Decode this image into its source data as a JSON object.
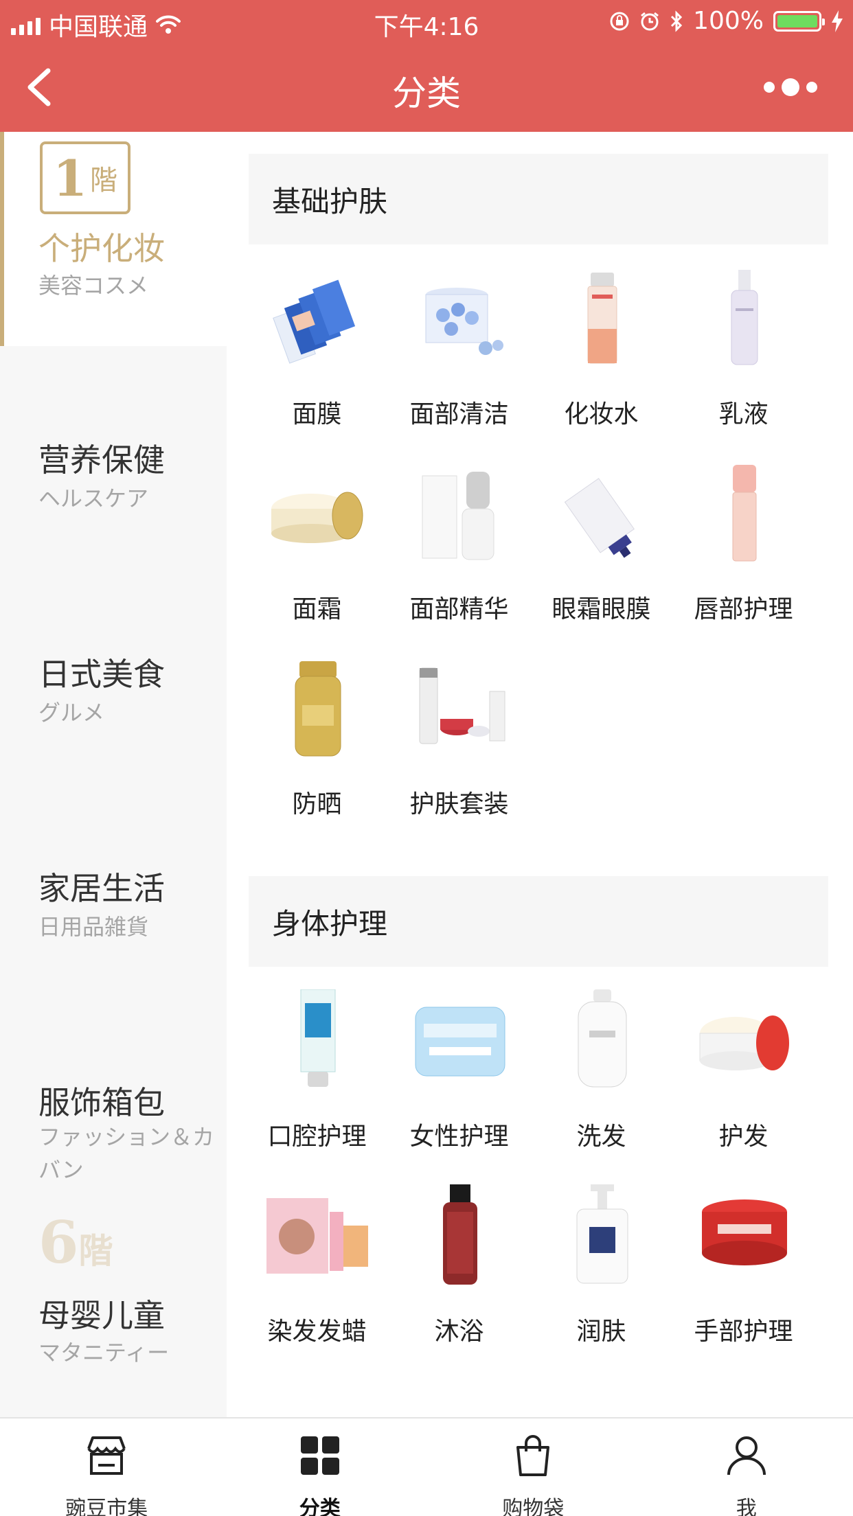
{
  "status_bar": {
    "carrier": "中国联通",
    "time": "下午4:16",
    "battery": "100%",
    "battery_level": 1.0,
    "battery_color": "#6edc5f"
  },
  "nav": {
    "title": "分类",
    "back_icon": "chevron-left-icon",
    "more_icon": "more-dots-icon"
  },
  "colors": {
    "brand": "#e05d58",
    "gold": "#c9ae7a"
  },
  "sidebar": {
    "floor_top": {
      "num": "1",
      "kai": "階"
    },
    "floor_ghost": {
      "num": "6",
      "kai": "階"
    },
    "items": [
      {
        "title": "个护化妆",
        "sub": "美容コスメ",
        "active": true
      },
      {
        "title": "营养保健",
        "sub": "ヘルスケア"
      },
      {
        "title": "日式美食",
        "sub": "グルメ"
      },
      {
        "title": "家居生活",
        "sub": "日用品雑貨"
      },
      {
        "title": "服饰箱包",
        "sub": "ファッション＆カバン"
      },
      {
        "title": "母婴儿童",
        "sub": "マタニティー"
      }
    ]
  },
  "sections": [
    {
      "title": "基础护肤",
      "items": [
        {
          "label": "面膜",
          "icon": "face-mask-icon"
        },
        {
          "label": "面部清洁",
          "icon": "cleansing-icon"
        },
        {
          "label": "化妆水",
          "icon": "toner-bottle-icon"
        },
        {
          "label": "乳液",
          "icon": "lotion-bottle-icon"
        },
        {
          "label": "面霜",
          "icon": "cream-jar-icon"
        },
        {
          "label": "面部精华",
          "icon": "serum-icon"
        },
        {
          "label": "眼霜眼膜",
          "icon": "eye-cream-tube-icon"
        },
        {
          "label": "唇部护理",
          "icon": "lip-balm-icon"
        },
        {
          "label": "防晒",
          "icon": "sunscreen-icon"
        },
        {
          "label": "护肤套装",
          "icon": "skincare-set-icon"
        }
      ]
    },
    {
      "title": "身体护理",
      "items": [
        {
          "label": "口腔护理",
          "icon": "toothpaste-icon"
        },
        {
          "label": "女性护理",
          "icon": "sanitary-pad-icon"
        },
        {
          "label": "洗发",
          "icon": "shampoo-bottle-icon"
        },
        {
          "label": "护发",
          "icon": "hair-mask-jar-icon"
        },
        {
          "label": "染发发蜡",
          "icon": "hair-dye-icon"
        },
        {
          "label": "沐浴",
          "icon": "body-wash-icon"
        },
        {
          "label": "润肤",
          "icon": "body-lotion-pump-icon"
        },
        {
          "label": "手部护理",
          "icon": "hand-cream-icon"
        }
      ]
    }
  ],
  "tabbar": [
    {
      "label": "豌豆市集",
      "icon": "store-icon"
    },
    {
      "label": "分类",
      "icon": "grid-icon",
      "active": true
    },
    {
      "label": "购物袋",
      "icon": "shopping-bag-icon"
    },
    {
      "label": "我",
      "icon": "person-icon"
    }
  ]
}
